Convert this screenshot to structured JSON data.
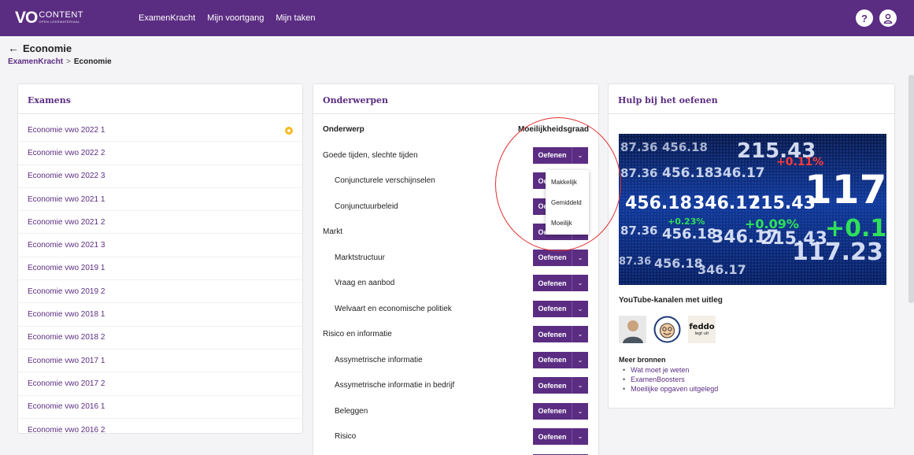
{
  "nav": {
    "logo_vo": "VO",
    "logo_content": "CONTENT",
    "logo_sub": "OPEN LEERMATERIAAL",
    "links": [
      "ExamenKracht",
      "Mijn voortgang",
      "Mijn taken"
    ],
    "help": "?",
    "profile": "8"
  },
  "header": {
    "back_arrow": "←",
    "title": "Economie",
    "breadcrumb": [
      "ExamenKracht",
      ">",
      "Economie"
    ]
  },
  "exams": {
    "title": "Examens",
    "items": [
      "Economie vwo 2022 1",
      "Economie vwo 2022 2",
      "Economie vwo 2022 3",
      "Economie vwo 2021 1",
      "Economie vwo 2021 2",
      "Economie vwo 2021 3",
      "Economie vwo 2019 1",
      "Economie vwo 2019 2",
      "Economie vwo 2018 1",
      "Economie vwo 2018 2",
      "Economie vwo 2017 1",
      "Economie vwo 2017 2",
      "Economie vwo 2016 1",
      "Economie vwo 2016 2"
    ]
  },
  "subjects": {
    "title": "Onderwerpen",
    "col_subject": "Onderwerp",
    "col_level": "Moeilijkheidsgraad",
    "button_label": "Oefenen",
    "caret": "⌄",
    "rows": [
      {
        "label": "Goede tijden, slechte tijden",
        "sub": false
      },
      {
        "label": "Conjuncturele verschijnselen",
        "sub": true
      },
      {
        "label": "Conjunctuurbeleid",
        "sub": true
      },
      {
        "label": "Markt",
        "sub": false
      },
      {
        "label": "Marktstructuur",
        "sub": true
      },
      {
        "label": "Vraag en aanbod",
        "sub": true
      },
      {
        "label": "Welvaart en economische politiek",
        "sub": true
      },
      {
        "label": "Risico en informatie",
        "sub": false
      },
      {
        "label": "Assymetrische informatie",
        "sub": true
      },
      {
        "label": "Assymetrische informatie in bedrijf",
        "sub": true
      },
      {
        "label": "Beleggen",
        "sub": true
      },
      {
        "label": "Risico",
        "sub": true
      },
      {
        "label": "",
        "sub": false
      }
    ],
    "dropdown": [
      "Makkelijk",
      "Gemiddeld",
      "Moeilijk"
    ]
  },
  "help": {
    "title": "Hulp bij het oefenen",
    "stock_numbers": [
      "117.23",
      "456.18",
      "346.17",
      "215.43",
      "87.36",
      "+0.11%",
      "+0.09%",
      "+0.23%"
    ],
    "youtube_title": "YouTube-kanalen met uitleg",
    "feddo_text": "feddo",
    "feddo_sub": "legt uit",
    "more_title": "Meer bronnen",
    "links": [
      "Wat moet je weten",
      "ExamenBoosters",
      "Moeilijke opgaven uitgelegd"
    ]
  },
  "colors": {
    "brand": "#5b2d82",
    "accent_dot": "#f5b91f",
    "highlight_circle": "#e03030"
  }
}
